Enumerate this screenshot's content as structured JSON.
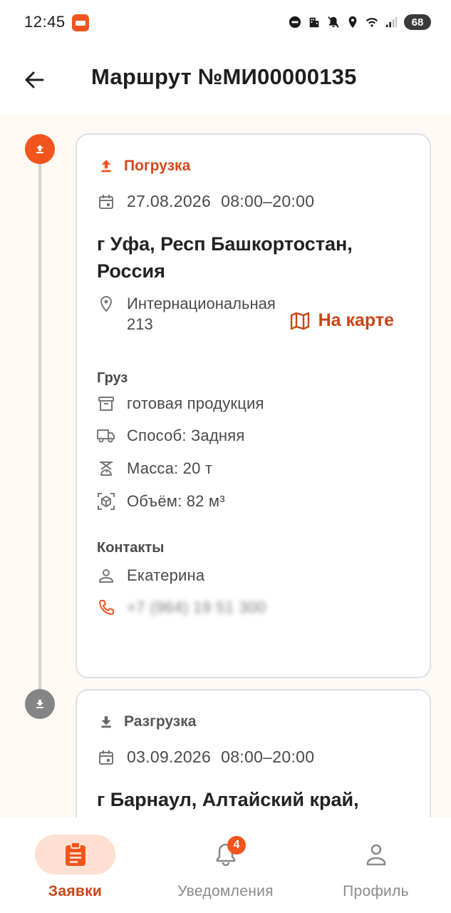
{
  "status_bar": {
    "time": "12:45",
    "battery": "68",
    "icons": [
      "app-notification-icon",
      "dnd-icon",
      "building-icon",
      "mute-icon",
      "location-icon",
      "wifi-icon",
      "signal-icon"
    ]
  },
  "header": {
    "title": "Маршрут №МИ00000135"
  },
  "colors": {
    "accent": "#f1551d",
    "accent_text": "#cc4417",
    "muted": "#858585",
    "content_bg": "#fff9f4"
  },
  "stops": [
    {
      "type_label": "Погрузка",
      "date": "27.08.2026",
      "time": "08:00–20:00",
      "city": "г Уфа, Респ Башкортостан, Россия",
      "address": "Интернациональная 213",
      "map_label": "На карте",
      "cargo": {
        "title": "Груз",
        "name": "готовая продукция",
        "method": "Способ: Задняя",
        "mass": "Масса: 20 т",
        "volume": "Объём: 82 м³"
      },
      "contacts": {
        "title": "Контакты",
        "person": "Екатерина",
        "phone": "+7 (964) 19 51 300"
      }
    },
    {
      "type_label": "Разгрузка",
      "date": "03.09.2026",
      "time": "08:00–20:00",
      "city": "г Барнаул, Алтайский край,"
    }
  ],
  "bottom_nav": {
    "items": [
      {
        "label": "Заявки",
        "icon": "clipboard-icon",
        "active": true
      },
      {
        "label": "Уведомления",
        "icon": "bell-icon",
        "badge": "4"
      },
      {
        "label": "Профиль",
        "icon": "person-icon"
      }
    ]
  }
}
